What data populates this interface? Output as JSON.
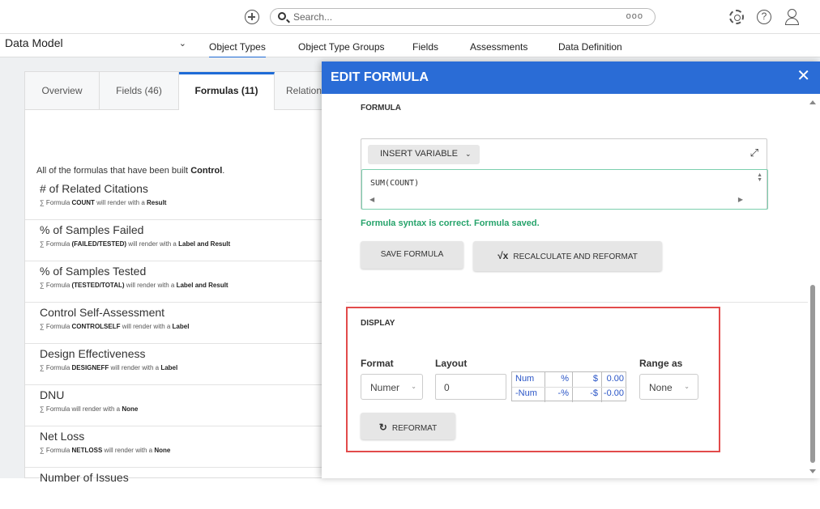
{
  "topbar": {
    "search_placeholder": "Search...",
    "search_more": "ooo",
    "help_glyph": "?"
  },
  "nav": {
    "data_model_label": "Data Model",
    "tabs": [
      "Object Types",
      "Object Type Groups",
      "Fields",
      "Assessments",
      "Data Definition"
    ],
    "active_tab": "Object Types"
  },
  "detail": {
    "tabs": [
      "Overview",
      "Fields (46)",
      "Formulas (11)",
      "Relation"
    ],
    "active_tab": "Formulas (11)",
    "intro_text": "All of the formulas that have been built",
    "intro_bold": "Control",
    "formulas": [
      {
        "title": "# of Related Citations",
        "prefix": "∑ Formula",
        "expr": "COUNT",
        "mid": "will render with a",
        "render": "Result"
      },
      {
        "title": "% of Samples Failed",
        "prefix": "∑ Formula",
        "expr": "(FAILED/TESTED)",
        "mid": "will render with a",
        "render": "Label and Result"
      },
      {
        "title": "% of Samples Tested",
        "prefix": "∑ Formula",
        "expr": "(TESTED/TOTAL)",
        "mid": "will render with a",
        "render": "Label and Result"
      },
      {
        "title": "Control Self-Assessment",
        "prefix": "∑ Formula",
        "expr": "CONTROLSELF",
        "mid": "will render with a",
        "render": "Label"
      },
      {
        "title": "Design Effectiveness",
        "prefix": "∑ Formula",
        "expr": "DESIGNEFF",
        "mid": "will render with a",
        "render": "Label"
      },
      {
        "title": "DNU",
        "prefix": "∑ Formula",
        "expr": "",
        "mid": "will render with a",
        "render": "None"
      },
      {
        "title": "Net Loss",
        "prefix": "∑ Formula",
        "expr": "NETLOSS",
        "mid": "will render with a",
        "render": "None"
      },
      {
        "title": "Number of Issues",
        "prefix": "",
        "expr": "",
        "mid": "",
        "render": ""
      }
    ]
  },
  "modal": {
    "title": "EDIT FORMULA",
    "close_glyph": "✕",
    "formula_section_label": "FORMULA",
    "insert_variable_label": "INSERT VARIABLE",
    "insert_variable_chevron": "⌄",
    "expand_glyph": "⤢",
    "formula_code": "SUM(COUNT)",
    "syntax_message": "Formula syntax is correct. Formula saved.",
    "save_formula_label": "SAVE FORMULA",
    "sqrt_glyph": "√x",
    "recalculate_label": "RECALCULATE AND REFORMAT",
    "display_section_label": "DISPLAY",
    "format_label": "Format",
    "format_value": "Numer",
    "layout_label": "Layout",
    "layout_value": "0",
    "preview": {
      "r1": [
        "Num",
        "%",
        "$",
        "0.00"
      ],
      "r2": [
        "-Num",
        "-%",
        "-$",
        "-0.00"
      ]
    },
    "range_label": "Range as",
    "range_value": "None",
    "refresh_glyph": "↻",
    "reformat_label": "REFORMAT"
  },
  "colors": {
    "accent": "#2a6cd6",
    "success": "#26a36b",
    "highlight": "#e24b4b"
  }
}
